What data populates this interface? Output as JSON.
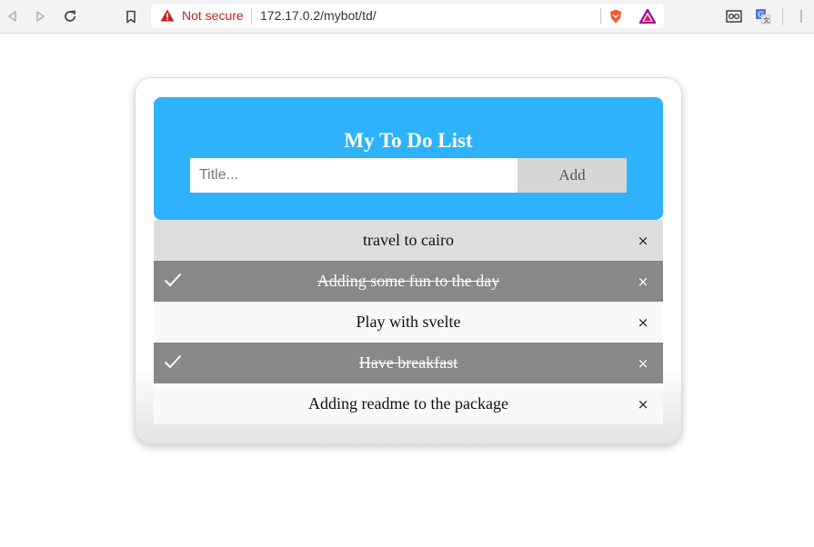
{
  "browser": {
    "security_label": "Not secure",
    "url": "172.17.0.2/mybot/td/",
    "icons": [
      "back-icon",
      "forward-icon",
      "reload-icon",
      "bookmark-icon",
      "warning-icon",
      "brave-shield-icon",
      "brave-rewards-icon",
      "reader-mode-icon",
      "translate-icon",
      "menu-icon"
    ]
  },
  "app": {
    "title": "My To Do List",
    "input_placeholder": "Title...",
    "add_label": "Add",
    "close_glyph": "×",
    "colors": {
      "header": "#2eb2fc",
      "checked_row": "#888888",
      "add_button": "#d6d6d6"
    },
    "items": [
      {
        "label": "travel to cairo",
        "checked": false,
        "shade": "mid"
      },
      {
        "label": "Adding some fun to the day",
        "checked": true
      },
      {
        "label": "Play with svelte",
        "checked": false,
        "shade": "light"
      },
      {
        "label": "Have breakfast",
        "checked": true
      },
      {
        "label": "Adding readme to the package",
        "checked": false,
        "shade": "light"
      }
    ]
  }
}
